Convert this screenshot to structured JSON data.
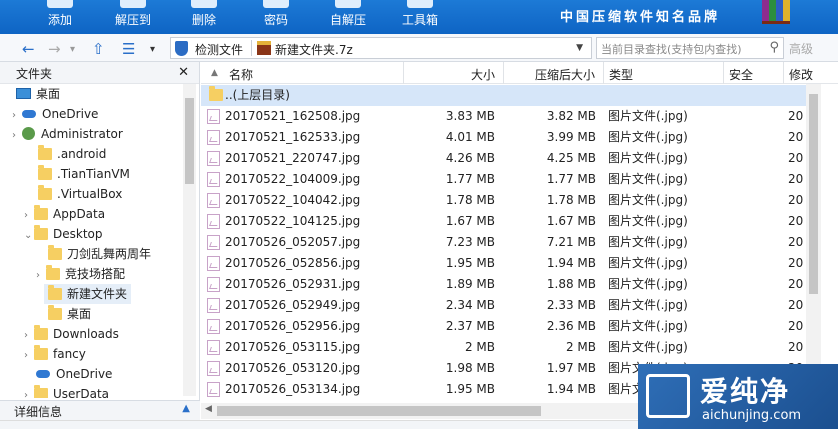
{
  "toolbar": {
    "buttons": [
      "添加",
      "解压到",
      "删除",
      "密码",
      "自解压",
      "工具箱"
    ],
    "brand": "中国压缩软件知名品牌"
  },
  "address": {
    "detect_label": "检测文件",
    "path": "新建文件夹.7z",
    "search_placeholder": "当前目录查找(支持包内查找)",
    "advanced_label": "高级"
  },
  "sidebar": {
    "title": "文件夹",
    "items": [
      {
        "label": "桌面",
        "icon": "desktop-icon"
      },
      {
        "label": "OneDrive",
        "icon": "onedrive-icon"
      },
      {
        "label": "Administrator",
        "icon": "user-icon"
      },
      {
        "label": ".android",
        "icon": "folder-icon"
      },
      {
        "label": ".TianTianVM",
        "icon": "folder-icon"
      },
      {
        "label": ".VirtualBox",
        "icon": "folder-icon"
      },
      {
        "label": "AppData",
        "icon": "folder-icon"
      },
      {
        "label": "Desktop",
        "icon": "folder-icon"
      },
      {
        "label": "刀剑乱舞两周年",
        "icon": "folder-icon"
      },
      {
        "label": "竞技场搭配",
        "icon": "folder-icon"
      },
      {
        "label": "新建文件夹",
        "icon": "folder-icon"
      },
      {
        "label": "桌面",
        "icon": "folder-icon"
      },
      {
        "label": "Downloads",
        "icon": "folder-icon"
      },
      {
        "label": "fancy",
        "icon": "folder-icon"
      },
      {
        "label": "OneDrive",
        "icon": "onedrive-icon"
      },
      {
        "label": "UserData",
        "icon": "folder-icon"
      }
    ],
    "detail_label": "详细信息"
  },
  "list": {
    "columns": [
      "名称",
      "大小",
      "压缩后大小",
      "类型",
      "安全",
      "修改"
    ],
    "parent_label": "..(上层目录)",
    "rows": [
      {
        "name": "20170521_162508.jpg",
        "size": "3.83 MB",
        "packed": "3.82 MB",
        "type": "图片文件(.jpg)",
        "mod": "20"
      },
      {
        "name": "20170521_162533.jpg",
        "size": "4.01 MB",
        "packed": "3.99 MB",
        "type": "图片文件(.jpg)",
        "mod": "20"
      },
      {
        "name": "20170521_220747.jpg",
        "size": "4.26 MB",
        "packed": "4.25 MB",
        "type": "图片文件(.jpg)",
        "mod": "20"
      },
      {
        "name": "20170522_104009.jpg",
        "size": "1.77 MB",
        "packed": "1.77 MB",
        "type": "图片文件(.jpg)",
        "mod": "20"
      },
      {
        "name": "20170522_104042.jpg",
        "size": "1.78 MB",
        "packed": "1.78 MB",
        "type": "图片文件(.jpg)",
        "mod": "20"
      },
      {
        "name": "20170522_104125.jpg",
        "size": "1.67 MB",
        "packed": "1.67 MB",
        "type": "图片文件(.jpg)",
        "mod": "20"
      },
      {
        "name": "20170526_052057.jpg",
        "size": "7.23 MB",
        "packed": "7.21 MB",
        "type": "图片文件(.jpg)",
        "mod": "20"
      },
      {
        "name": "20170526_052856.jpg",
        "size": "1.95 MB",
        "packed": "1.94 MB",
        "type": "图片文件(.jpg)",
        "mod": "20"
      },
      {
        "name": "20170526_052931.jpg",
        "size": "1.89 MB",
        "packed": "1.88 MB",
        "type": "图片文件(.jpg)",
        "mod": "20"
      },
      {
        "name": "20170526_052949.jpg",
        "size": "2.34 MB",
        "packed": "2.33 MB",
        "type": "图片文件(.jpg)",
        "mod": "20"
      },
      {
        "name": "20170526_052956.jpg",
        "size": "2.37 MB",
        "packed": "2.36 MB",
        "type": "图片文件(.jpg)",
        "mod": "20"
      },
      {
        "name": "20170526_053115.jpg",
        "size": "2 MB",
        "packed": "2 MB",
        "type": "图片文件(.jpg)",
        "mod": "20"
      },
      {
        "name": "20170526_053120.jpg",
        "size": "1.98 MB",
        "packed": "1.97 MB",
        "type": "图片文件(.jpg)",
        "mod": "20"
      },
      {
        "name": "20170526_053134.jpg",
        "size": "1.95 MB",
        "packed": "1.94 MB",
        "type": "图片文",
        "mod": "20"
      }
    ]
  },
  "watermark": {
    "title": "爱纯净",
    "url": "aichunjing.com"
  }
}
